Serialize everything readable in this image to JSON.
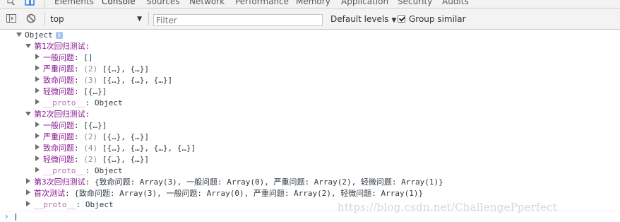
{
  "tabs": [
    {
      "label": "Elements"
    },
    {
      "label": "Console"
    },
    {
      "label": "Sources"
    },
    {
      "label": "Network"
    },
    {
      "label": "Performance"
    },
    {
      "label": "Memory"
    },
    {
      "label": "Application"
    },
    {
      "label": "Security"
    },
    {
      "label": "Audits"
    }
  ],
  "toolbar": {
    "context": "top",
    "filter_placeholder": "Filter",
    "levels_label": "Default levels",
    "group_similar_label": "Group similar",
    "group_similar_checked": true
  },
  "tree": {
    "root": "Object",
    "groups": [
      {
        "label": "第1次回归测试:",
        "items": [
          {
            "key": "一般问题",
            "value": "[]"
          },
          {
            "key": "严重问题",
            "count": "(2)",
            "value": "[{…}, {…}]"
          },
          {
            "key": "致命问题",
            "count": "(3)",
            "value": "[{…}, {…}, {…}]"
          },
          {
            "key": "轻微问题",
            "value": "[{…}]"
          }
        ],
        "proto": {
          "key": "__proto__",
          "value": "Object"
        }
      },
      {
        "label": "第2次回归测试:",
        "items": [
          {
            "key": "一般问题",
            "value": "[{…}]"
          },
          {
            "key": "严重问题",
            "count": "(2)",
            "value": "[{…}, {…}]"
          },
          {
            "key": "致命问题",
            "count": "(4)",
            "value": "[{…}, {…}, {…}, {…}]"
          },
          {
            "key": "轻微问题",
            "count": "(2)",
            "value": "[{…}, {…}]"
          }
        ],
        "proto": {
          "key": "__proto__",
          "value": "Object"
        }
      }
    ],
    "collapsed": [
      {
        "label": "第3次回归测试",
        "value": "{致命问题: Array(3), 一般问题: Array(0), 严重问题: Array(2), 轻微问题: Array(1)}"
      },
      {
        "label": "首次测试",
        "value": "{致命问题: Array(3), 一般问题: Array(0), 严重问题: Array(2), 轻微问题: Array(1)}"
      }
    ],
    "root_proto": {
      "key": "__proto__",
      "value": "Object"
    }
  },
  "watermark": "https://blog.csdn.net/ChallengePperfect"
}
